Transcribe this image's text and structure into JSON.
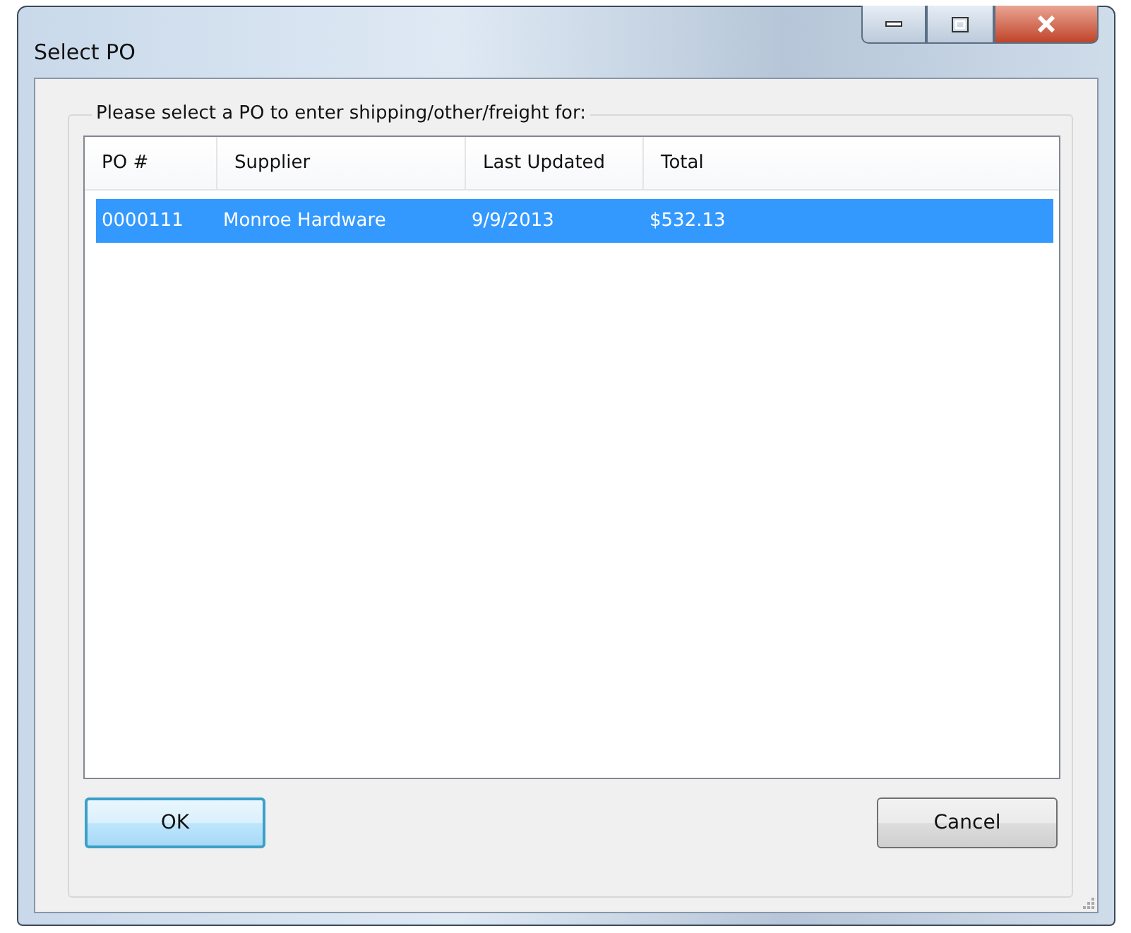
{
  "window": {
    "title": "Select PO"
  },
  "group": {
    "label": "Please select a PO to enter shipping/other/freight for:"
  },
  "table": {
    "columns": [
      "PO #",
      "Supplier",
      "Last Updated",
      "Total"
    ],
    "rows": [
      {
        "cells": [
          "0000111",
          "Monroe Hardware",
          "9/9/2013",
          "$532.13"
        ],
        "selected": true
      }
    ]
  },
  "buttons": [
    {
      "label": "OK",
      "default": true
    },
    {
      "label": "Cancel",
      "default": false
    }
  ]
}
